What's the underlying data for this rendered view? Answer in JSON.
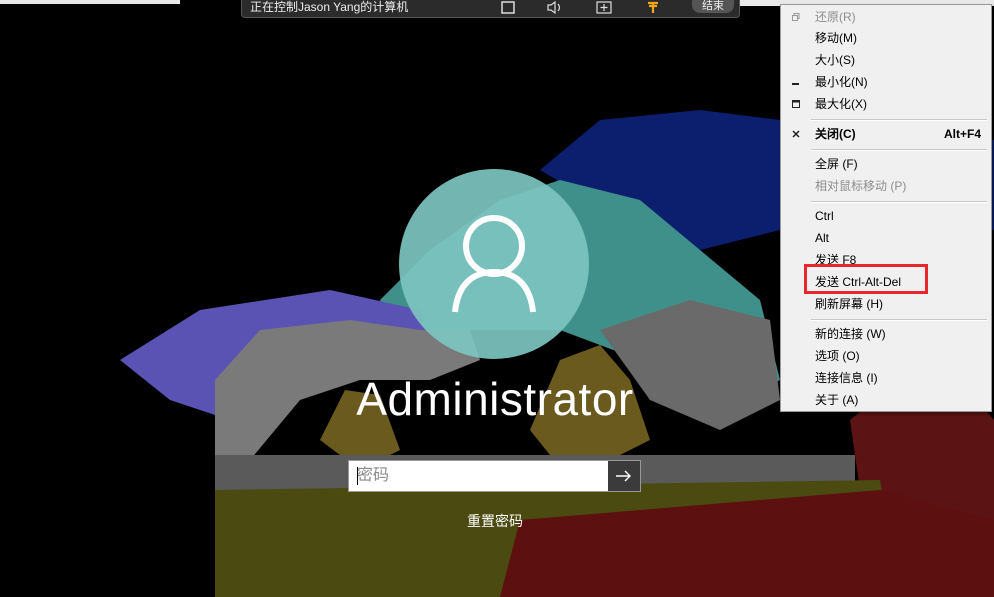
{
  "topbar": {
    "title": "正在控制Jason Yang的计算机",
    "end_label": "结束"
  },
  "login": {
    "username": "Administrator",
    "password_placeholder": "密码",
    "reset_label": "重置密码"
  },
  "menu": {
    "items": [
      {
        "label": "还原(R)",
        "icon": "restore-icon",
        "disabled": true
      },
      {
        "label": "移动(M)"
      },
      {
        "label": "大小(S)"
      },
      {
        "label": "最小化(N)",
        "icon": "minimize-icon"
      },
      {
        "label": "最大化(X)",
        "icon": "maximize-icon"
      },
      {
        "label": "关闭(C)",
        "icon": "close-icon",
        "shortcut": "Alt+F4",
        "bold": true
      },
      {
        "label": "全屏 (F)"
      },
      {
        "label": "相对鼠标移动 (P)",
        "disabled": true
      },
      {
        "label": "Ctrl"
      },
      {
        "label": "Alt"
      },
      {
        "label": "发送 F8"
      },
      {
        "label": "发送 Ctrl-Alt-Del",
        "highlighted": true
      },
      {
        "label": "刷新屏幕 (H)"
      },
      {
        "label": "新的连接 (W)"
      },
      {
        "label": "选项 (O)"
      },
      {
        "label": "连接信息 (I)"
      },
      {
        "label": "关于 (A)"
      }
    ]
  },
  "colors": {
    "highlight_border": "#e8262e",
    "avatar_circle": "#7cc4c0",
    "topbar_bg": "#2b2b2b"
  }
}
